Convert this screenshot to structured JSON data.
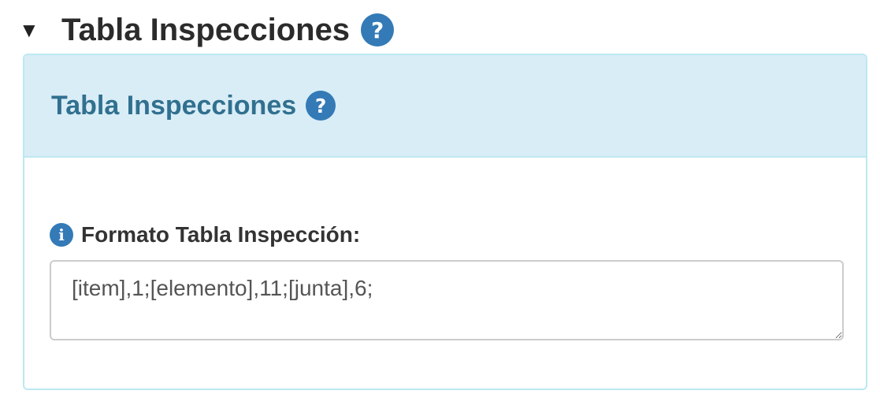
{
  "section": {
    "toggle_glyph": "▼",
    "title": "Tabla Inspecciones",
    "help_glyph": "?"
  },
  "panel": {
    "title": "Tabla Inspecciones",
    "help_glyph": "?"
  },
  "field": {
    "info_glyph": "i",
    "label": "Formato Tabla Inspección:",
    "value": "[item],1;[elemento],11;[junta],6;"
  },
  "colors": {
    "accent": "#337ab7",
    "panel_heading_bg": "#d9edf7",
    "panel_border": "#bce8f1",
    "panel_title": "#31708f"
  }
}
